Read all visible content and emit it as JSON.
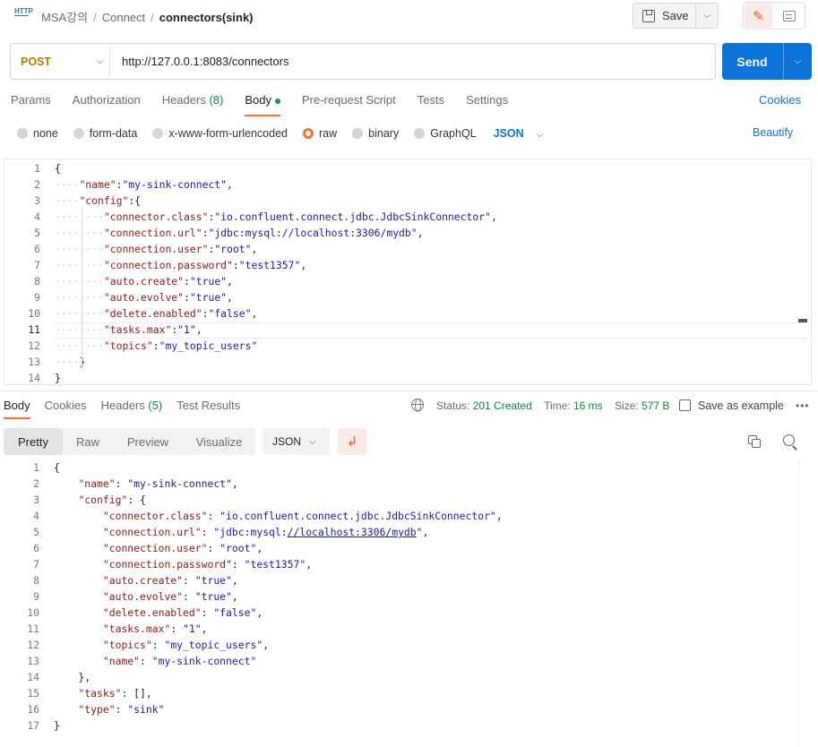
{
  "breadcrumb": {
    "icon_text": "HTTP",
    "items": [
      "MSA강의",
      "Connect"
    ],
    "current": "connectors(sink)"
  },
  "toolbar": {
    "save_label": "Save"
  },
  "request": {
    "method": "POST",
    "url": "http://127.0.0.1:8083/connectors",
    "send_label": "Send"
  },
  "request_tabs": [
    {
      "label": "Params"
    },
    {
      "label": "Authorization"
    },
    {
      "label": "Headers",
      "count": "(8)"
    },
    {
      "label": "Body"
    },
    {
      "label": "Pre-request Script"
    },
    {
      "label": "Tests"
    },
    {
      "label": "Settings"
    }
  ],
  "cookies_label": "Cookies",
  "body_types": [
    "none",
    "form-data",
    "x-www-form-urlencoded",
    "raw",
    "binary",
    "GraphQL"
  ],
  "body_format": "JSON",
  "beautify_label": "Beautify",
  "request_body": [
    "{",
    "    \"name\":\"my-sink-connect\",",
    "    \"config\":{",
    "        \"connector.class\":\"io.confluent.connect.jdbc.JdbcSinkConnector\",",
    "        \"connection.url\":\"jdbc:mysql://localhost:3306/mydb\",",
    "        \"connection.user\":\"root\",",
    "        \"connection.password\":\"test1357\",",
    "        \"auto.create\":\"true\",",
    "        \"auto.evolve\":\"true\",",
    "        \"delete.enabled\":\"false\",",
    "        \"tasks.max\":\"1\",",
    "        \"topics\":\"my_topic_users\"",
    "    }",
    "}"
  ],
  "response_tabs": [
    {
      "label": "Body"
    },
    {
      "label": "Cookies"
    },
    {
      "label": "Headers",
      "count": "(5)"
    },
    {
      "label": "Test Results"
    }
  ],
  "response_status": {
    "status_label": "Status:",
    "status_value": "201 Created",
    "time_label": "Time:",
    "time_value": "16 ms",
    "size_label": "Size:",
    "size_value": "577 B"
  },
  "save_example_label": "Save as example",
  "view_options": [
    "Pretty",
    "Raw",
    "Preview",
    "Visualize"
  ],
  "response_format": "JSON",
  "response_body": [
    "{",
    "    \"name\": \"my-sink-connect\",",
    "    \"config\": {",
    "        \"connector.class\": \"io.confluent.connect.jdbc.JdbcSinkConnector\",",
    "        \"connection.url\": \"jdbc:mysql://localhost:3306/mydb\",",
    "        \"connection.user\": \"root\",",
    "        \"connection.password\": \"test1357\",",
    "        \"auto.create\": \"true\",",
    "        \"auto.evolve\": \"true\",",
    "        \"delete.enabled\": \"false\",",
    "        \"tasks.max\": \"1\",",
    "        \"topics\": \"my_topic_users\",",
    "        \"name\": \"my-sink-connect\"",
    "    },",
    "    \"tasks\": [],",
    "    \"type\": \"sink\"",
    "}"
  ],
  "colors": {
    "accent": "#ff6c37",
    "primary": "#0b73da",
    "success": "#0b8a3c",
    "method_post": "#ad7a03"
  }
}
